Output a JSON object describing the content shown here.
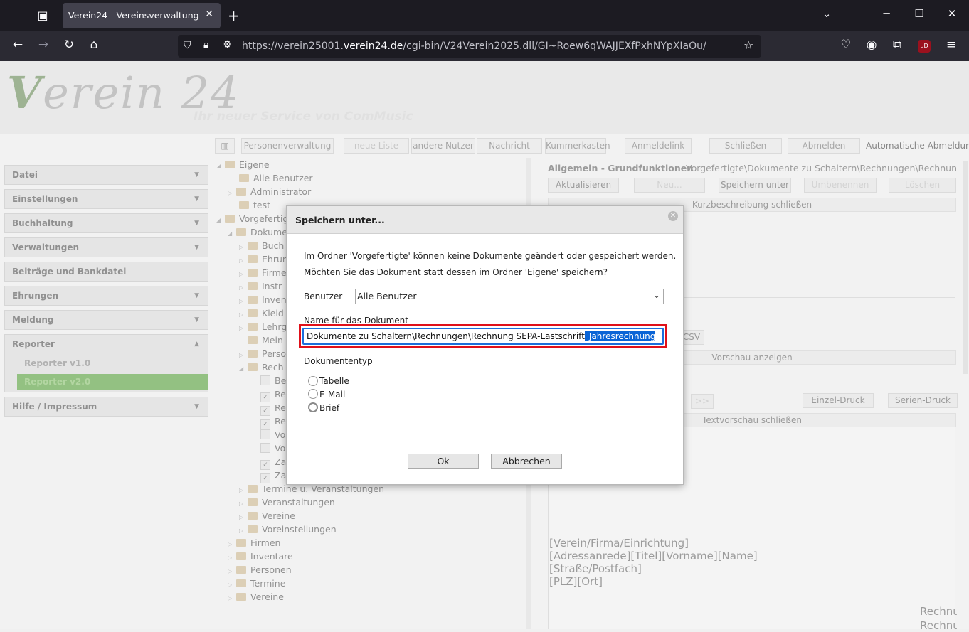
{
  "browser": {
    "tab_title": "Verein24 - Vereinsverwaltung",
    "url_prefix": "https://verein25001.",
    "url_domain": "verein24.de",
    "url_path": "/cgi-bin/V24Verein2025.dll/GI~Roew6qWAJJEXfPxhNYpXIaOu/",
    "ublock_badge": "uD"
  },
  "header": {
    "logo_v": "V",
    "logo_rest": "erein 24",
    "slogan": "Ihr neuer Service von ComMusic"
  },
  "toolbar": {
    "personen": "Personenverwaltung",
    "neue_liste": "neue Liste",
    "andere_nutzer": "andere Nutzer",
    "nachricht": "Nachricht",
    "kummerkasten": "Kummerkasten",
    "anmeldelink": "Anmeldelink",
    "schliessen": "Schließen",
    "abmelden": "Abmelden",
    "auto_abmeldung": "Automatische Abmeldung"
  },
  "sidebar": {
    "items": [
      "Datei",
      "Einstellungen",
      "Buchhaltung",
      "Verwaltungen",
      "Beiträge und Bankdatei",
      "Ehrungen",
      "Meldung",
      "Reporter"
    ],
    "reporter_sub": [
      "Reporter v1.0",
      "Reporter v2.0"
    ],
    "help": "Hilfe / Impressum"
  },
  "tree": {
    "eigene": "Eigene",
    "alle_benutzer": "Alle Benutzer",
    "administrator": "Administrator",
    "test": "test",
    "vorgefertigte": "Vorgefertigte",
    "dokumente": "Dokumente",
    "sub": [
      "Buch",
      "Ehrun",
      "Firme",
      "Instr",
      "Inven",
      "Kleid",
      "Lehrg",
      "Mein",
      "Perso",
      "Rech"
    ],
    "rech_children": [
      "Be",
      "Re",
      "Re",
      "Re",
      "Vo",
      "Vo",
      "Za",
      "Za"
    ],
    "lower": [
      "Termine u. Veranstaltungen",
      "Veranstaltungen",
      "Vereine",
      "Voreinstellungen"
    ],
    "top_level": [
      "Firmen",
      "Inventare",
      "Personen",
      "Termine",
      "Vereine"
    ]
  },
  "right": {
    "heading": "Allgemein - Grundfunktionen",
    "path": "Vorgefertigte\\Dokumente zu Schaltern\\Rechnungen\\Rechnung SEPA",
    "aktualisieren": "Aktualisieren",
    "neu": "Neu...",
    "speichern_unter": "Speichern unter",
    "umbenennen": "Umbenennen",
    "loeschen": "Löschen",
    "kurzbeschreibung": "Kurzbeschreibung schließen",
    "csv": "CSV",
    "vorschau": "Vorschau anzeigen",
    "next": ">>",
    "einzel": "Einzel-Druck",
    "serien": "Serien-Druck",
    "textvorschau": "Textvorschau schließen",
    "doc_lines": [
      "[Verein/Firma/Einrichtung]",
      "[Adressanrede][Titel][Vorname][Name]",
      "[Straße/Postfach]",
      "[PLZ][Ort]"
    ],
    "doc_right": [
      "Rechnu",
      "Rechnu"
    ]
  },
  "dialog": {
    "title": "Speichern unter...",
    "message1": "Im Ordner 'Vorgefertigte' können keine Dokumente geändert oder gespeichert werden.",
    "message2": "Möchten Sie das Dokument statt dessen im Ordner 'Eigene' speichern?",
    "benutzer_label": "Benutzer",
    "benutzer_value": "Alle Benutzer",
    "name_label": "Name für das Dokument",
    "name_value_plain": "Dokumente zu Schaltern\\Rechnungen\\Rechnung SEPA-Lastschrift",
    "name_value_selected": "_Jahresrechnung",
    "doctype_label": "Dokumententyp",
    "doctypes": [
      "Tabelle",
      "E-Mail",
      "Brief"
    ],
    "doctype_selected": "Brief",
    "ok": "Ok",
    "cancel": "Abbrechen"
  }
}
